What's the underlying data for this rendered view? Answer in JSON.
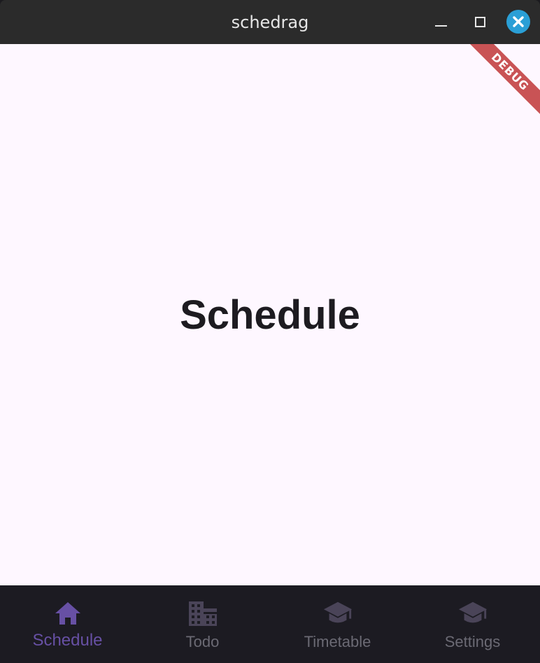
{
  "window": {
    "title": "schedrag"
  },
  "content": {
    "heading": "Schedule",
    "debug_banner": "DEBUG"
  },
  "nav": {
    "items": [
      {
        "label": "Schedule",
        "icon": "home-icon",
        "active": true
      },
      {
        "label": "Todo",
        "icon": "building-icon",
        "active": false
      },
      {
        "label": "Timetable",
        "icon": "graduation-cap-icon",
        "active": false
      },
      {
        "label": "Settings",
        "icon": "graduation-cap-icon",
        "active": false
      }
    ]
  },
  "colors": {
    "accent": "#6750a4",
    "inactive": "#4a4458",
    "background": "#fef7ff",
    "navbar": "#1c1b22"
  }
}
